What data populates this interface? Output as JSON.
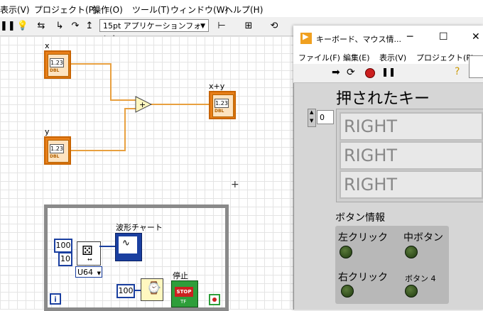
{
  "menu": [
    "表示(V)",
    "プロジェクト(P)",
    "操作(O)",
    "ツール(T)",
    "ウィンドウ(W)",
    "ヘルプ(H)"
  ],
  "toolbar": {
    "font": "15pt アプリケーションフォント"
  },
  "diagram": {
    "x_label": "x",
    "y_label": "y",
    "sum_label": "x+y",
    "num_display": "1.23",
    "type_badge": "DBL",
    "add_symbol": "+",
    "const_100": "100",
    "const_10": "10",
    "u64": "U64",
    "chart_label": "波形チャート",
    "stop_label": "停止",
    "const_wait": "100",
    "stop_text": "STOP",
    "tf_text": "TF",
    "iter": "i"
  },
  "front_panel": {
    "title": "キーボード、マウス情...",
    "menu": [
      "ファイル(F)",
      "編集(E)",
      "表示(V)",
      "プロジェクト(P)"
    ],
    "heading": "押されたキー",
    "index": "0",
    "keys": [
      "RIGHT",
      "RIGHT",
      "RIGHT"
    ],
    "button_info_label": "ボタン情報",
    "buttons": [
      "左クリック",
      "中ボタン",
      "右クリック",
      "ボタン 4"
    ]
  }
}
